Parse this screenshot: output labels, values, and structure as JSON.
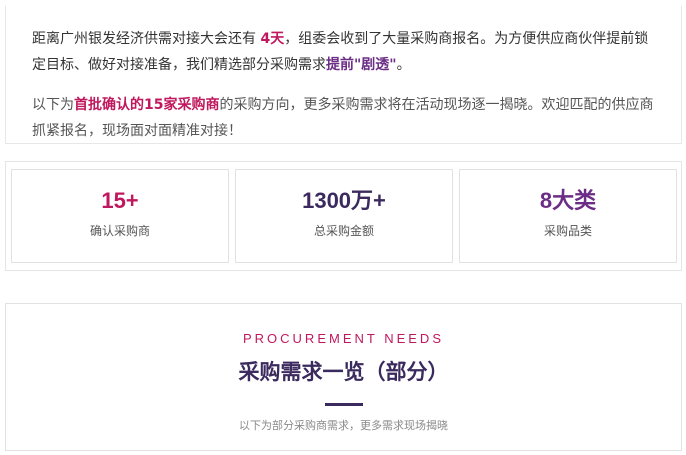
{
  "intro": {
    "p1_a": "距离广州银发经济供需对接大会还有 ",
    "p1_days": "4天",
    "p1_b": "，组委会收到了大量采购商报名。为方便供应商伙伴提前锁定目标、做好对接准备，我们精选部分采购需求",
    "p1_highlight": "提前\"剧透\"",
    "p1_end": "。",
    "p2_a": "以下为",
    "p2_highlight": "首批确认的15家采购商",
    "p2_b": "的采购方向，更多采购需求将在活动现场逐一揭晓。欢迎匹配的供应商抓紧报名，现场面对面精准对接！"
  },
  "stats": [
    {
      "value": "15+",
      "label": "确认采购商",
      "color": "#c0185e"
    },
    {
      "value": "1300万+",
      "label": "总采购金额",
      "color": "#3b2a5e"
    },
    {
      "value": "8大类",
      "label": "采购品类",
      "color": "#6b2d86"
    }
  ],
  "procurement": {
    "en_title": "PROCUREMENT NEEDS",
    "title": "采购需求一览（部分）",
    "subtitle": "以下为部分采购商需求，更多需求现场揭晓"
  },
  "colors": {
    "accent": "#c0185e",
    "dark": "#3b2a5e",
    "purple": "#6b2d86"
  }
}
